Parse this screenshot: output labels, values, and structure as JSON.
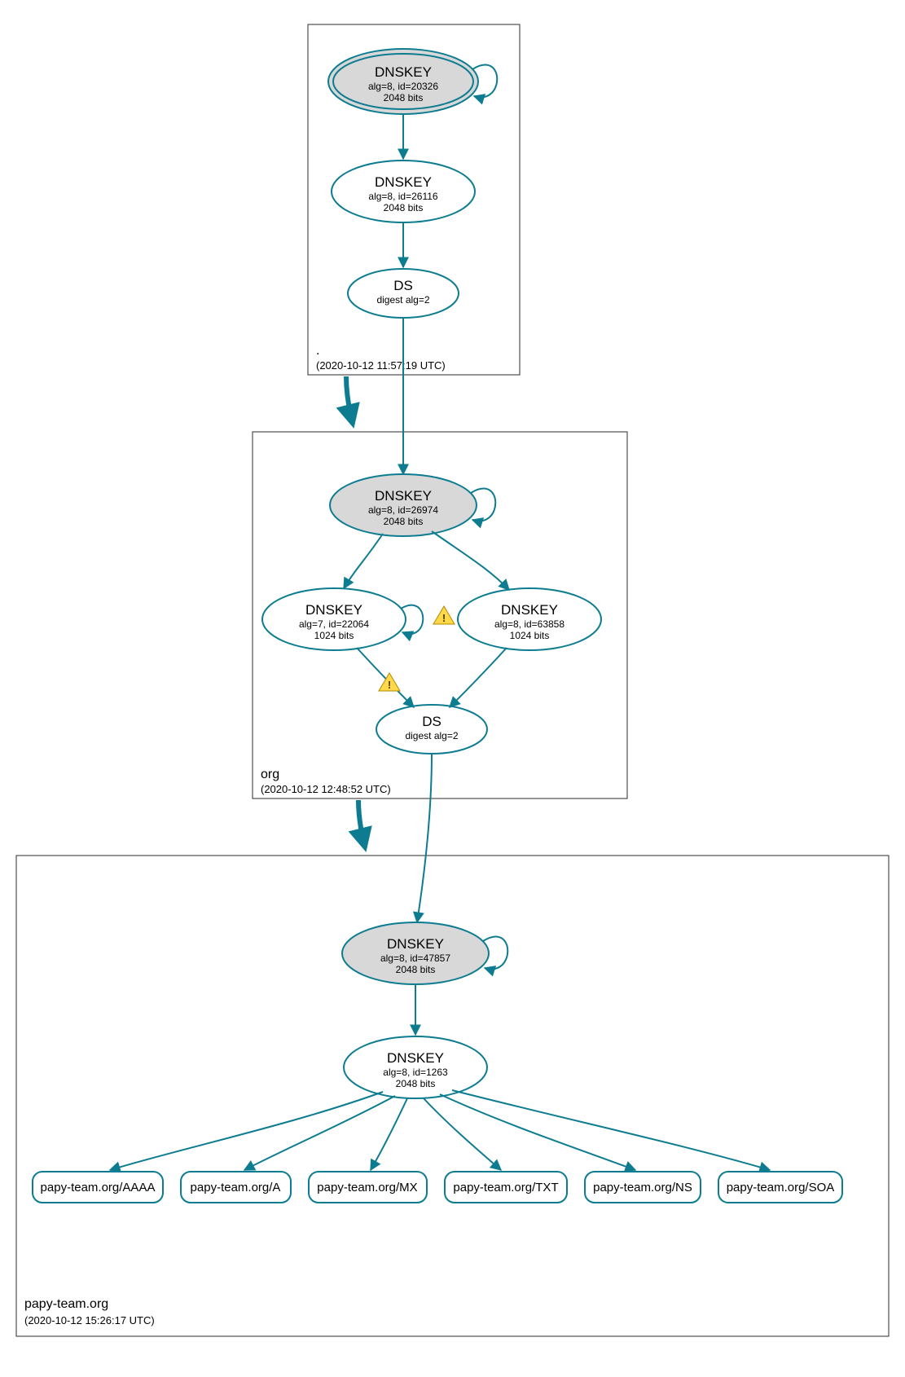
{
  "colors": {
    "stroke": "#0d7c91",
    "ksk_fill": "#d8d8d8",
    "warn_fill": "#ffd94a",
    "warn_stroke": "#b58900"
  },
  "zones": {
    "root": {
      "label": ".",
      "timestamp": "(2020-10-12 11:57:19 UTC)"
    },
    "org": {
      "label": "org",
      "timestamp": "(2020-10-12 12:48:52 UTC)"
    },
    "leaf": {
      "label": "papy-team.org",
      "timestamp": "(2020-10-12 15:26:17 UTC)"
    }
  },
  "nodes": {
    "root_ksk": {
      "title": "DNSKEY",
      "line1": "alg=8, id=20326",
      "line2": "2048 bits"
    },
    "root_zsk": {
      "title": "DNSKEY",
      "line1": "alg=8, id=26116",
      "line2": "2048 bits"
    },
    "root_ds": {
      "title": "DS",
      "line1": "digest alg=2",
      "line2": ""
    },
    "org_ksk": {
      "title": "DNSKEY",
      "line1": "alg=8, id=26974",
      "line2": "2048 bits"
    },
    "org_zsk_a": {
      "title": "DNSKEY",
      "line1": "alg=7, id=22064",
      "line2": "1024 bits"
    },
    "org_zsk_b": {
      "title": "DNSKEY",
      "line1": "alg=8, id=63858",
      "line2": "1024 bits"
    },
    "org_ds": {
      "title": "DS",
      "line1": "digest alg=2",
      "line2": ""
    },
    "leaf_ksk": {
      "title": "DNSKEY",
      "line1": "alg=8, id=47857",
      "line2": "2048 bits"
    },
    "leaf_zsk": {
      "title": "DNSKEY",
      "line1": "alg=8, id=1263",
      "line2": "2048 bits"
    }
  },
  "rrsets": {
    "rr0": "papy-team.org/AAAA",
    "rr1": "papy-team.org/A",
    "rr2": "papy-team.org/MX",
    "rr3": "papy-team.org/TXT",
    "rr4": "papy-team.org/NS",
    "rr5": "papy-team.org/SOA"
  },
  "warnings": {
    "warn_org_self": true,
    "warn_org_ds": true
  }
}
